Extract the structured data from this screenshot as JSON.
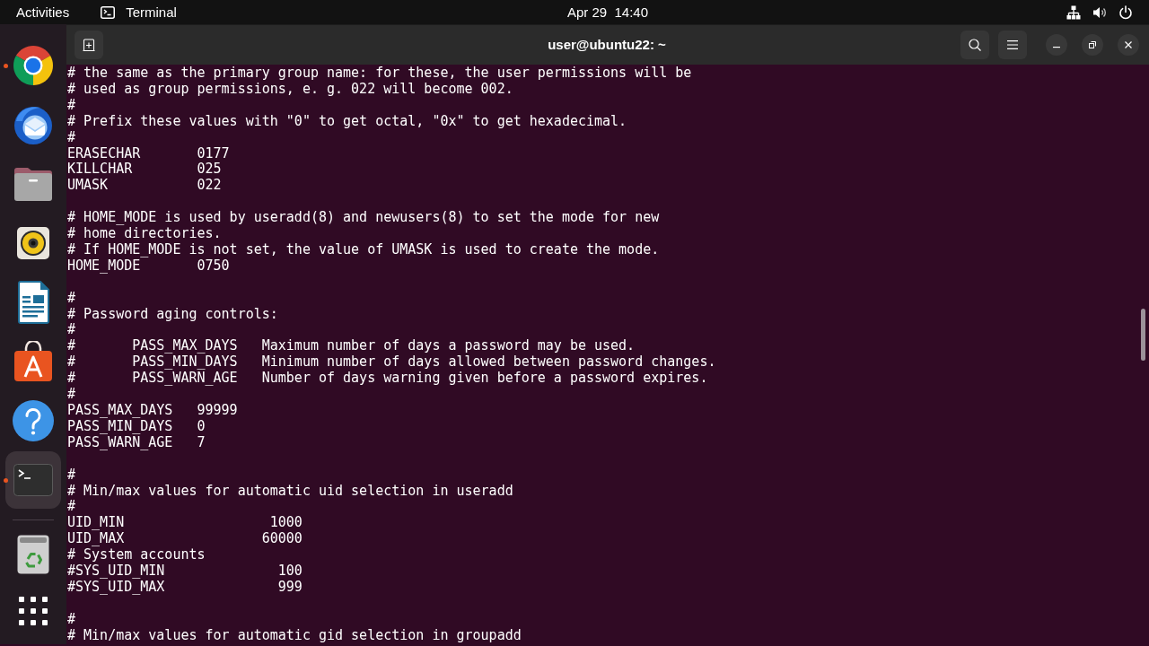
{
  "top_bar": {
    "activities": "Activities",
    "app_menu": "Terminal",
    "clock": "Apr 29  14:40"
  },
  "dock": {
    "apps": [
      {
        "kind": "browser",
        "running": true,
        "active": false
      },
      {
        "kind": "mail",
        "running": false,
        "active": false
      },
      {
        "kind": "files",
        "running": false,
        "active": false
      },
      {
        "kind": "music",
        "running": false,
        "active": false
      },
      {
        "kind": "writer",
        "running": false,
        "active": false
      },
      {
        "kind": "store",
        "running": false,
        "active": false
      },
      {
        "kind": "help",
        "running": false,
        "active": false
      },
      {
        "kind": "terminal",
        "running": true,
        "active": true
      }
    ],
    "extras": [
      {
        "kind": "trash",
        "running": false,
        "active": false
      }
    ]
  },
  "window": {
    "title": "user@ubuntu22: ~"
  },
  "terminal": {
    "blocks": [
      [
        "# the same as the primary group name: for these, the user permissions will be",
        "# used as group permissions, e. g. 022 will become 002.",
        "#",
        "# Prefix these values with \"0\" to get octal, \"0x\" to get hexadecimal.",
        "#",
        "ERASECHAR       0177",
        "KILLCHAR        025",
        "UMASK           022"
      ],
      [
        "# HOME_MODE is used by useradd(8) and newusers(8) to set the mode for new",
        "# home directories.",
        "# If HOME_MODE is not set, the value of UMASK is used to create the mode.",
        "HOME_MODE       0750"
      ],
      [
        "#",
        "# Password aging controls:",
        "#",
        "#       PASS_MAX_DAYS   Maximum number of days a password may be used.",
        "#       PASS_MIN_DAYS   Minimum number of days allowed between password changes.",
        "#       PASS_WARN_AGE   Number of days warning given before a password expires.",
        "#",
        "PASS_MAX_DAYS   99999",
        "PASS_MIN_DAYS   0",
        "PASS_WARN_AGE   7"
      ],
      [
        "#",
        "# Min/max values for automatic uid selection in useradd",
        "#",
        "UID_MIN                  1000",
        "UID_MAX                 60000",
        "# System accounts",
        "#SYS_UID_MIN              100",
        "#SYS_UID_MAX              999"
      ],
      [
        "#",
        "# Min/max values for automatic gid selection in groupadd"
      ]
    ]
  }
}
